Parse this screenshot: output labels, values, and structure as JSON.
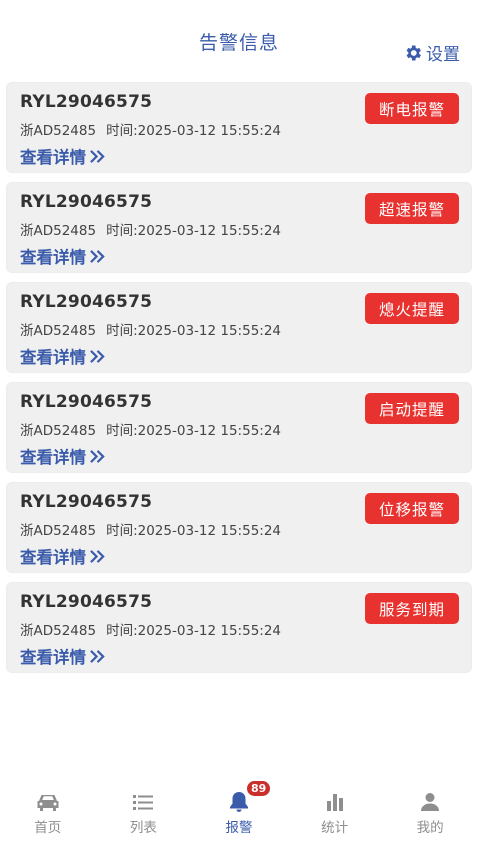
{
  "header": {
    "title": "告警信息",
    "settings_label": "设置",
    "settings_icon": "gear-icon"
  },
  "alerts": [
    {
      "id": "RYL29046575",
      "plate": "浙AD52485",
      "time": "时间:2025-03-12  15:55:24",
      "link": "查看详情",
      "badge": "断电报警"
    },
    {
      "id": "RYL29046575",
      "plate": "浙AD52485",
      "time": "时间:2025-03-12  15:55:24",
      "link": "查看详情",
      "badge": "超速报警"
    },
    {
      "id": "RYL29046575",
      "plate": "浙AD52485",
      "time": "时间:2025-03-12  15:55:24",
      "link": "查看详情",
      "badge": "熄火提醒"
    },
    {
      "id": "RYL29046575",
      "plate": "浙AD52485",
      "time": "时间:2025-03-12  15:55:24",
      "link": "查看详情",
      "badge": "启动提醒"
    },
    {
      "id": "RYL29046575",
      "plate": "浙AD52485",
      "time": "时间:2025-03-12  15:55:24",
      "link": "查看详情",
      "badge": "位移报警"
    },
    {
      "id": "RYL29046575",
      "plate": "浙AD52485",
      "time": "时间:2025-03-12  15:55:24",
      "link": "查看详情",
      "badge": "服务到期"
    }
  ],
  "colors": {
    "accent": "#3b5cab",
    "badge": "#e8322f",
    "card_bg": "#f0f0f0"
  },
  "tabbar": {
    "items": [
      {
        "label": "首页",
        "icon": "car-icon"
      },
      {
        "label": "列表",
        "icon": "list-icon"
      },
      {
        "label": "报警",
        "icon": "bell-icon",
        "active": true,
        "badge": "89"
      },
      {
        "label": "统计",
        "icon": "bar-chart-icon"
      },
      {
        "label": "我的",
        "icon": "user-icon"
      }
    ]
  }
}
